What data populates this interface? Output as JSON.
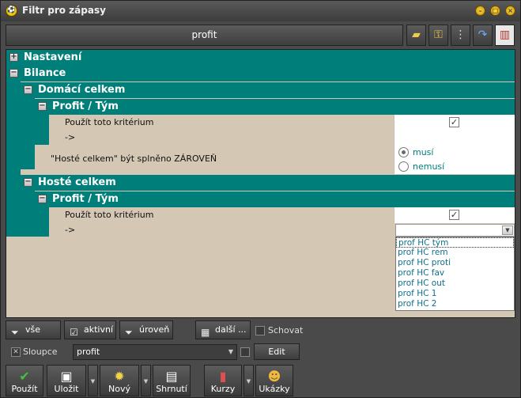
{
  "window": {
    "title": "Filtr pro zápasy"
  },
  "topbar": {
    "profit_label": "profit"
  },
  "tree": {
    "nastaveni": "Nastavení",
    "bilance": "Bilance",
    "domaci": "Domácí celkem",
    "profit_tym": "Profit / Tým",
    "pouzit": "Použít toto kritérium",
    "arrow": "->",
    "hoste_cond": "\"Hosté celkem\" být splněno ZÁROVEŇ",
    "musi": "musí",
    "nemusi": "nemusí",
    "hoste": "Hosté celkem",
    "profit_tym2": "Profit / Tým",
    "pouzit2": "Použít toto kritérium",
    "arrow2": "->"
  },
  "dropdown": {
    "options": [
      "prof HC tým",
      "prof HC rem",
      "prof HC proti",
      "prof HC fav",
      "prof HC out",
      "prof HC 1",
      "prof HC 2"
    ]
  },
  "toolbar1": {
    "vse": "vše",
    "aktivni": "aktivní",
    "uroven": "úroveň",
    "dalsi": "další ...",
    "schovat": "Schovat"
  },
  "toolbar2": {
    "sloupce": "Sloupce",
    "combo_value": "profit",
    "edit": "Edit"
  },
  "toolbar3": {
    "pouzit": "Použít",
    "ulozit": "Uložit",
    "novy": "Nový",
    "shrnuti": "Shrnutí",
    "kurzy": "Kurzy",
    "ukazky": "Ukázky"
  },
  "colors": {
    "teal": "#007e7a",
    "panel": "#d4c8b4",
    "chrome": "#4a4a4a"
  }
}
